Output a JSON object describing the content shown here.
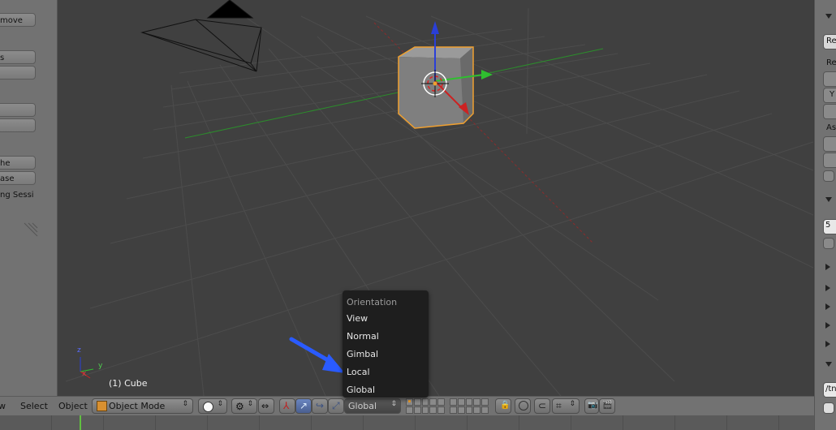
{
  "left_panel": {
    "buttons": [
      "move",
      "s",
      "",
      "",
      "",
      "he",
      "ase"
    ],
    "session_text": "ng Sessi"
  },
  "viewport": {
    "object_label": "(1) Cube",
    "axis_x": "x",
    "axis_y": "y",
    "axis_z": "z"
  },
  "toolbar": {
    "view": "w",
    "select": "Select",
    "object": "Object",
    "mode": "Object Mode",
    "orientation_value": "Global"
  },
  "orientation_menu": {
    "title": "Orientation",
    "items": [
      "View",
      "Normal",
      "Gimbal",
      "Local",
      "Global"
    ]
  },
  "right_panel": {
    "re_btn": "Re",
    "re_label": "Re",
    "y_label": "Y",
    "as_label": "As",
    "num_value": "5",
    "path_value": "/tn"
  },
  "colors": {
    "menu_bg": "#1e1e1e",
    "accent_blue": "#2a5bff",
    "cube_outline": "#f0a030"
  }
}
